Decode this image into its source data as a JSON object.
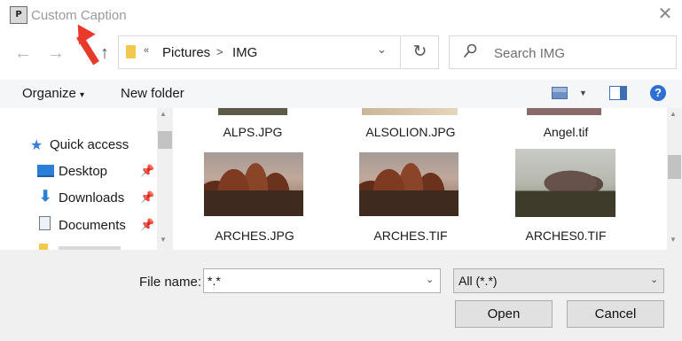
{
  "window": {
    "title": "Custom Caption",
    "icon_text": "P"
  },
  "address": {
    "chevron": "«",
    "crumbs": [
      "Pictures",
      "IMG"
    ],
    "separator": ">"
  },
  "search": {
    "placeholder": "Search IMG"
  },
  "toolbar": {
    "organize": "Organize",
    "organize_caret": "▾",
    "new_folder": "New folder",
    "help": "?"
  },
  "sidebar": {
    "items": [
      {
        "label": "Quick access",
        "icon": "star-icon",
        "pinned": false
      },
      {
        "label": "Desktop",
        "icon": "desktop-icon",
        "pinned": true
      },
      {
        "label": "Downloads",
        "icon": "download-arrow-icon",
        "pinned": true
      },
      {
        "label": "Documents",
        "icon": "document-icon",
        "pinned": true
      }
    ]
  },
  "files": [
    {
      "name": "ALPS.JPG"
    },
    {
      "name": "ALSOLION.JPG"
    },
    {
      "name": "Angel.tif"
    },
    {
      "name": "ARCHES.JPG"
    },
    {
      "name": "ARCHES.TIF"
    },
    {
      "name": "ARCHES0.TIF"
    }
  ],
  "bottom": {
    "file_name_label": "File name:",
    "file_name_value": "*.*",
    "filter_value": "All (*.*)",
    "open_label": "Open",
    "cancel_label": "Cancel"
  },
  "colors": {
    "accent": "#2e6fd1",
    "annotation_arrow": "#e8392a",
    "folder": "#f2c94c"
  }
}
